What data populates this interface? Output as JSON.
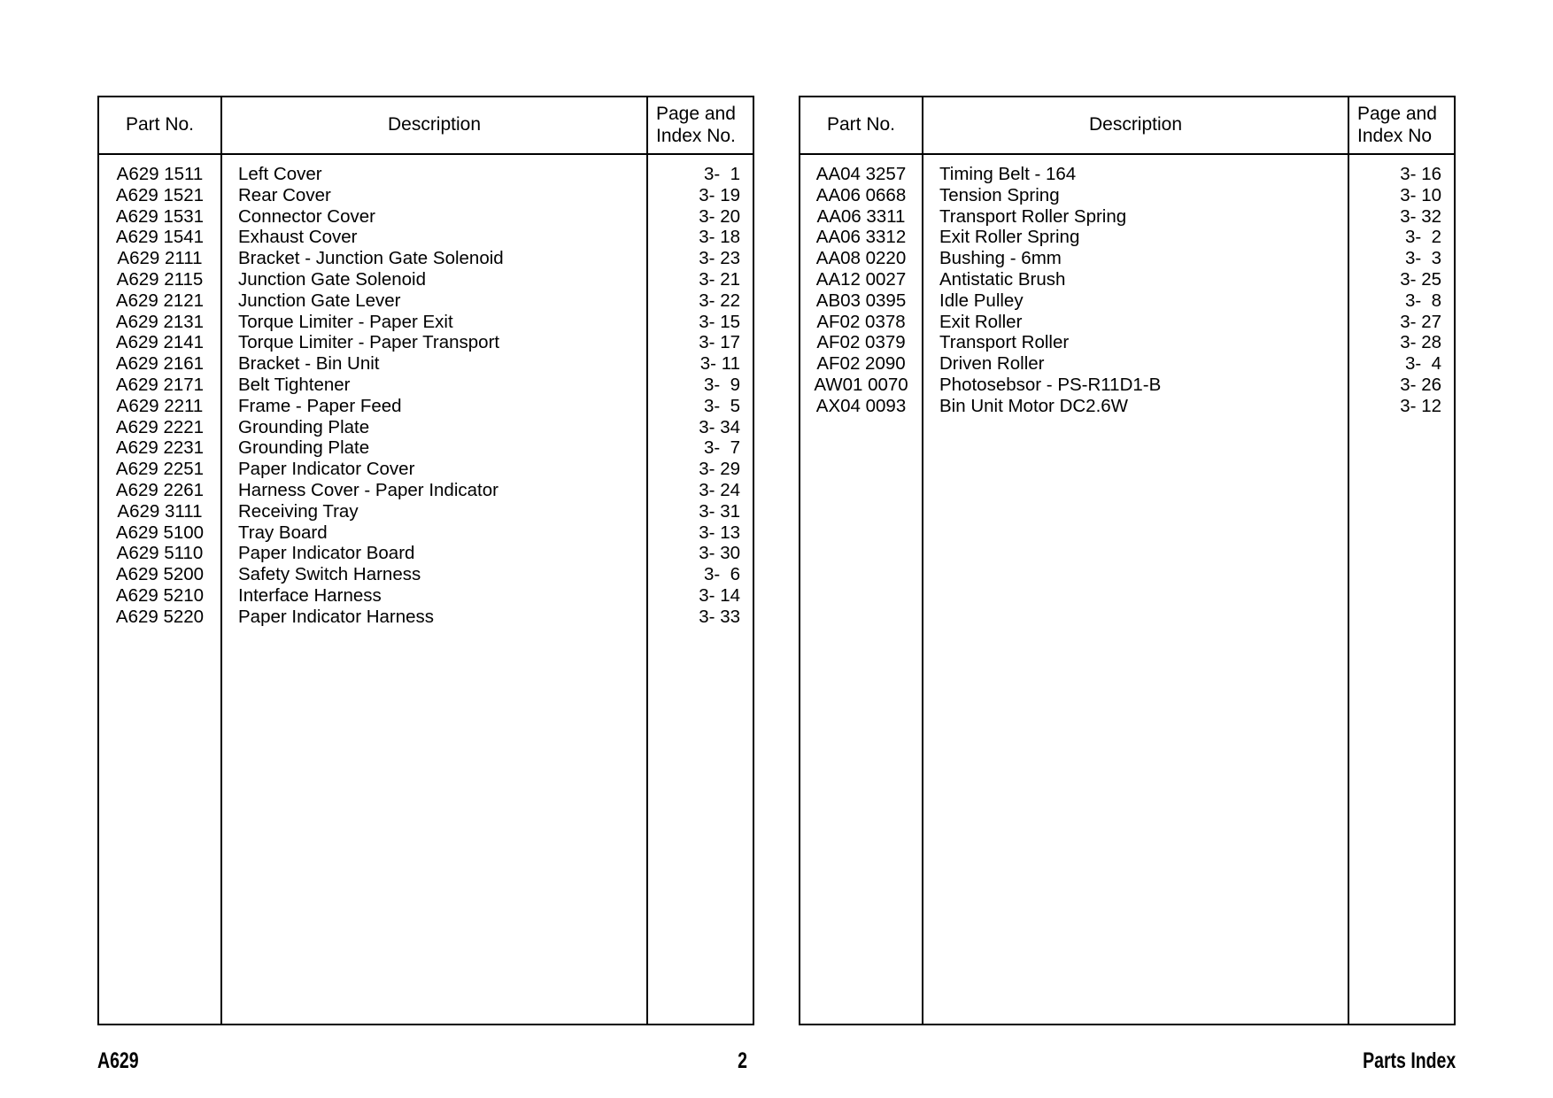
{
  "document": {
    "title": "Parts Index",
    "model_code": "A629",
    "page_number": "2"
  },
  "tables": [
    {
      "id": "left-table",
      "headers": {
        "part_no": "Part No.",
        "description": "Description",
        "page_index": "Page and\nIndex No."
      },
      "rows": [
        {
          "part_no": "A629 1511",
          "description": "Left Cover",
          "page_index": "3-  1"
        },
        {
          "part_no": "A629 1521",
          "description": "Rear Cover",
          "page_index": "3- 19"
        },
        {
          "part_no": "A629 1531",
          "description": "Connector Cover",
          "page_index": "3- 20"
        },
        {
          "part_no": "A629 1541",
          "description": "Exhaust Cover",
          "page_index": "3- 18"
        },
        {
          "part_no": "A629 2111",
          "description": "Bracket - Junction Gate Solenoid",
          "page_index": "3- 23"
        },
        {
          "part_no": "A629 2115",
          "description": "Junction Gate Solenoid",
          "page_index": "3- 21"
        },
        {
          "part_no": "A629 2121",
          "description": "Junction Gate Lever",
          "page_index": "3- 22"
        },
        {
          "part_no": "A629 2131",
          "description": "Torque Limiter - Paper Exit",
          "page_index": "3- 15"
        },
        {
          "part_no": "A629 2141",
          "description": "Torque Limiter - Paper Transport",
          "page_index": "3- 17"
        },
        {
          "part_no": "A629 2161",
          "description": "Bracket - Bin Unit",
          "page_index": "3- 11"
        },
        {
          "part_no": "A629 2171",
          "description": "Belt Tightener",
          "page_index": "3-  9"
        },
        {
          "part_no": "A629 2211",
          "description": "Frame - Paper Feed",
          "page_index": "3-  5"
        },
        {
          "part_no": "A629 2221",
          "description": "Grounding Plate",
          "page_index": "3- 34"
        },
        {
          "part_no": "A629 2231",
          "description": "Grounding Plate",
          "page_index": "3-  7"
        },
        {
          "part_no": "A629 2251",
          "description": "Paper Indicator Cover",
          "page_index": "3- 29"
        },
        {
          "part_no": "A629 2261",
          "description": "Harness Cover - Paper Indicator",
          "page_index": "3- 24"
        },
        {
          "part_no": "A629 3111",
          "description": "Receiving Tray",
          "page_index": "3- 31"
        },
        {
          "part_no": "A629 5100",
          "description": "Tray Board",
          "page_index": "3- 13"
        },
        {
          "part_no": "A629 5110",
          "description": "Paper Indicator Board",
          "page_index": "3- 30"
        },
        {
          "part_no": "A629 5200",
          "description": "Safety Switch Harness",
          "page_index": "3-  6"
        },
        {
          "part_no": "A629 5210",
          "description": "Interface Harness",
          "page_index": "3- 14"
        },
        {
          "part_no": "A629 5220",
          "description": "Paper Indicator Harness",
          "page_index": "3- 33"
        }
      ]
    },
    {
      "id": "right-table",
      "headers": {
        "part_no": "Part No.",
        "description": "Description",
        "page_index": "Page and\nIndex No"
      },
      "rows": [
        {
          "part_no": "AA04 3257",
          "description": "Timing Belt - 164",
          "page_index": "3- 16"
        },
        {
          "part_no": "AA06 0668",
          "description": "Tension Spring",
          "page_index": "3- 10"
        },
        {
          "part_no": "AA06 3311",
          "description": "Transport Roller Spring",
          "page_index": "3- 32"
        },
        {
          "part_no": "AA06 3312",
          "description": "Exit Roller Spring",
          "page_index": "3-  2"
        },
        {
          "part_no": "AA08 0220",
          "description": "Bushing - 6mm",
          "page_index": "3-  3"
        },
        {
          "part_no": "AA12 0027",
          "description": "Antistatic Brush",
          "page_index": "3- 25"
        },
        {
          "part_no": "AB03 0395",
          "description": "Idle Pulley",
          "page_index": "3-  8"
        },
        {
          "part_no": "AF02 0378",
          "description": "Exit Roller",
          "page_index": "3- 27"
        },
        {
          "part_no": "AF02 0379",
          "description": "Transport Roller",
          "page_index": "3- 28"
        },
        {
          "part_no": "AF02 2090",
          "description": "Driven Roller",
          "page_index": "3-  4"
        },
        {
          "part_no": "AW01 0070",
          "description": "Photosebsor - PS-R11D1-B",
          "page_index": "3- 26"
        },
        {
          "part_no": "AX04 0093",
          "description": "Bin Unit Motor DC2.6W",
          "page_index": "3- 12"
        }
      ]
    }
  ],
  "footer": {
    "left": "A629",
    "center": "2",
    "right": "Parts Index"
  },
  "colors": {
    "background": "#ffffff",
    "text": "#000000",
    "border": "#000000"
  }
}
